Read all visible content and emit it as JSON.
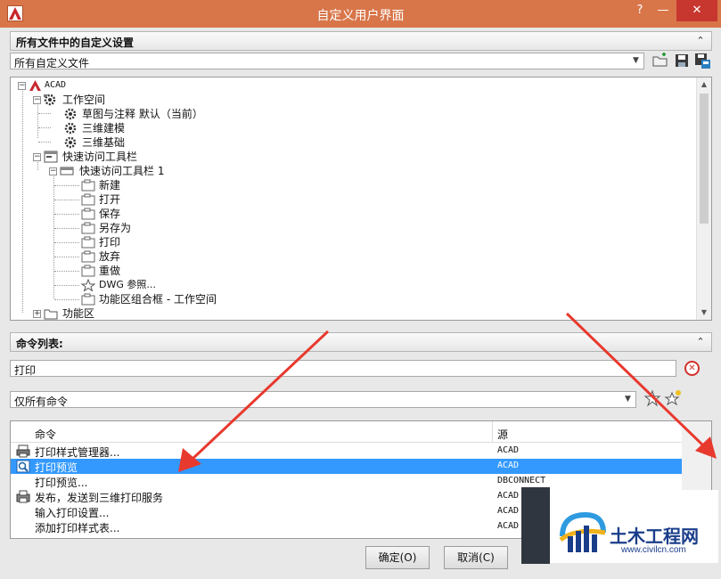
{
  "window": {
    "title": "自定义用户界面",
    "help": "?",
    "minimize": "—",
    "close": "✕"
  },
  "customizations": {
    "header": "所有文件中的自定义设置",
    "collapse": "⌃",
    "file_select": "所有自定义文件",
    "tree": {
      "root": "ACAD",
      "workspaces": "工作空间",
      "ws_items": [
        "草图与注释 默认（当前）",
        "三维建模",
        "三维基础"
      ],
      "qat": "快速访问工具栏",
      "qat1": "快速访问工具栏 1",
      "qat_items": [
        "新建",
        "打开",
        "保存",
        "另存为",
        "打印",
        "放弃",
        "重做",
        "DWG 参照...",
        "功能区组合框 - 工作空间"
      ],
      "ribbon": "功能区"
    }
  },
  "command_list": {
    "header": "命令列表:",
    "search_value": "打印",
    "filter_select": "仅所有命令",
    "columns": {
      "command": "命令",
      "source": "源"
    },
    "rows": [
      {
        "name": "打印样式管理器...",
        "source": "ACAD",
        "icon": "printer-icon",
        "selected": false
      },
      {
        "name": "打印预览",
        "source": "ACAD",
        "icon": "preview-icon",
        "selected": true
      },
      {
        "name": "打印预览...",
        "source": "DBCONNECT",
        "icon": "",
        "selected": false
      },
      {
        "name": "发布，发送到三维打印服务",
        "source": "ACAD",
        "icon": "3d-print-icon",
        "selected": false
      },
      {
        "name": "输入打印设置...",
        "source": "ACAD",
        "icon": "",
        "selected": false
      },
      {
        "name": "添加打印样式表...",
        "source": "ACAD",
        "icon": "",
        "selected": false
      }
    ]
  },
  "buttons": {
    "ok": "确定(O)",
    "cancel": "取消(C)"
  },
  "watermark": {
    "name": "土木工程网",
    "url": "www.civilcn.com"
  },
  "colors": {
    "titlebar": "#d8764a",
    "selection": "#3399ff",
    "annotation_arrow": "#e8392e"
  }
}
